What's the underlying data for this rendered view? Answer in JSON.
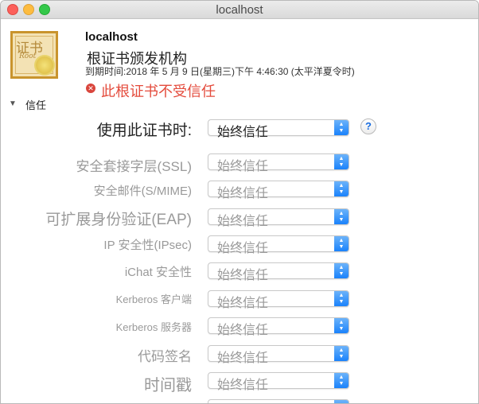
{
  "window": {
    "title": "localhost"
  },
  "certificate": {
    "icon_glyph": "证书",
    "icon_subtext": "Root",
    "name": "localhost",
    "issuer": "根证书颁发机构",
    "expires": "到期时间:2018 年 5 月 9 日(星期三)下午 4:46:30 (太平洋夏令时)",
    "warning": "此根证书不受信任"
  },
  "trust": {
    "section_label": "信任",
    "help_label": "?",
    "rows": [
      {
        "label": "使用此证书时:",
        "value": "始终信任"
      },
      {
        "label": "安全套接字层(SSL)",
        "value": "始终信任"
      },
      {
        "label": "安全邮件(S/MIME)",
        "value": "始终信任"
      },
      {
        "label": "可扩展身份验证(EAP)",
        "value": "始终信任"
      },
      {
        "label": "IP 安全性(IPsec)",
        "value": "始终信任"
      },
      {
        "label": "iChat 安全性",
        "value": "始终信任"
      },
      {
        "label": "Kerberos 客户端",
        "value": "始终信任"
      },
      {
        "label": "Kerberos 服务器",
        "value": "始终信任"
      },
      {
        "label": "代码签名",
        "value": "始终信任"
      },
      {
        "label": "时间戳",
        "value": "始终信任"
      }
    ]
  }
}
